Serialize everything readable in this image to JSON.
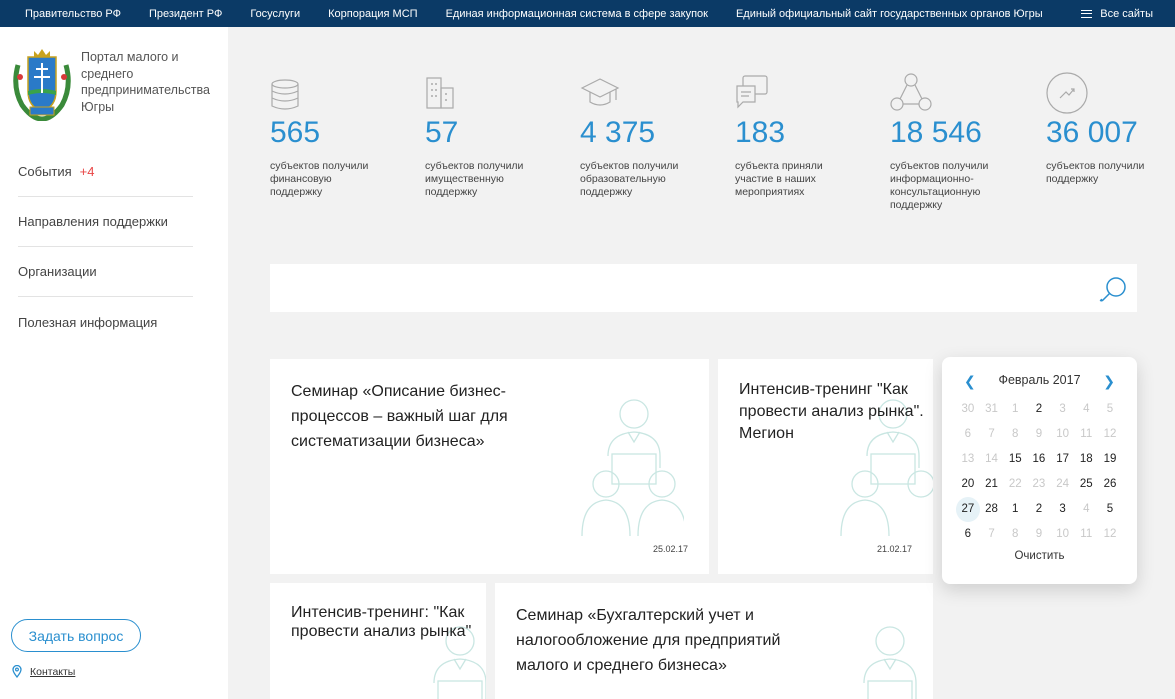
{
  "topbar": {
    "links": [
      "Правительство РФ",
      "Президент РФ",
      "Госуслуги",
      "Корпорация МСП",
      "Единая информационная система в сфере закупок",
      "Единый официальный сайт государственных органов Югры"
    ],
    "all_sites": "Все сайты"
  },
  "sidebar": {
    "portal_title": "Портал малого и среднего предпринимательства Югры",
    "nav": [
      {
        "label": "События",
        "badge": "+4"
      },
      {
        "label": "Направления поддержки"
      },
      {
        "label": "Организации"
      },
      {
        "label": "Полезная информация"
      }
    ],
    "ask_button": "Задать вопрос",
    "contacts": "Контакты"
  },
  "stats": [
    {
      "icon": "coins-stack-icon",
      "number": "565",
      "desc": "субъектов получили финансовую поддержку"
    },
    {
      "icon": "building-icon",
      "number": "57",
      "desc": "субъектов получили имущественную поддержку"
    },
    {
      "icon": "graduation-cap-icon",
      "number": "4 375",
      "desc": "субъектов получили образовательную поддержку"
    },
    {
      "icon": "chat-bubbles-icon",
      "number": "183",
      "desc": "субъекта приняли участие в наших мероприятиях"
    },
    {
      "icon": "network-icon",
      "number": "18 546",
      "desc": "субъектов получили информационно-консультационную поддержку"
    },
    {
      "icon": "trend-circle-icon",
      "number": "36 007",
      "desc": "субъектов получили поддержку"
    }
  ],
  "search": {
    "placeholder": ""
  },
  "cards": [
    {
      "title": "Семинар «Описание бизнес-процессов – важный шаг для систематизации бизнеса»",
      "date": "25.02.17"
    },
    {
      "title": "Интенсив-тренинг \"Как провести анализ рынка\". Мегион",
      "date": "21.02.17"
    },
    {
      "title": "Интенсив-тренинг: \"Как провести анализ рынка\"",
      "date": ""
    },
    {
      "title": "Семинар «Бухгалтерский учет и налогообложение для предприятий малого и среднего бизнеса»",
      "date": ""
    }
  ],
  "calendar": {
    "month": "Февраль 2017",
    "clear": "Очистить",
    "weeks": [
      [
        {
          "d": "30",
          "m": true
        },
        {
          "d": "31",
          "m": true
        },
        {
          "d": "1",
          "m": true
        },
        {
          "d": "2"
        },
        {
          "d": "3",
          "m": true
        },
        {
          "d": "4",
          "m": true
        },
        {
          "d": "5",
          "m": true
        }
      ],
      [
        {
          "d": "6",
          "m": true
        },
        {
          "d": "7",
          "m": true
        },
        {
          "d": "8",
          "m": true
        },
        {
          "d": "9",
          "m": true
        },
        {
          "d": "10",
          "m": true
        },
        {
          "d": "11",
          "m": true
        },
        {
          "d": "12",
          "m": true
        }
      ],
      [
        {
          "d": "13",
          "m": true
        },
        {
          "d": "14",
          "m": true
        },
        {
          "d": "15"
        },
        {
          "d": "16"
        },
        {
          "d": "17"
        },
        {
          "d": "18"
        },
        {
          "d": "19"
        }
      ],
      [
        {
          "d": "20"
        },
        {
          "d": "21"
        },
        {
          "d": "22",
          "m": true
        },
        {
          "d": "23",
          "m": true
        },
        {
          "d": "24",
          "m": true
        },
        {
          "d": "25"
        },
        {
          "d": "26"
        }
      ],
      [
        {
          "d": "27",
          "t": true
        },
        {
          "d": "28"
        },
        {
          "d": "1"
        },
        {
          "d": "2"
        },
        {
          "d": "3"
        },
        {
          "d": "4",
          "m": true
        },
        {
          "d": "5"
        }
      ],
      [
        {
          "d": "6"
        },
        {
          "d": "7",
          "m": true
        },
        {
          "d": "8",
          "m": true
        },
        {
          "d": "9",
          "m": true
        },
        {
          "d": "10",
          "m": true
        },
        {
          "d": "11",
          "m": true
        },
        {
          "d": "12",
          "m": true
        }
      ]
    ]
  },
  "colors": {
    "topbar": "#0b3a66",
    "accent": "#2a8fcf",
    "badge": "#e84545",
    "art": "#c9e6e2"
  }
}
